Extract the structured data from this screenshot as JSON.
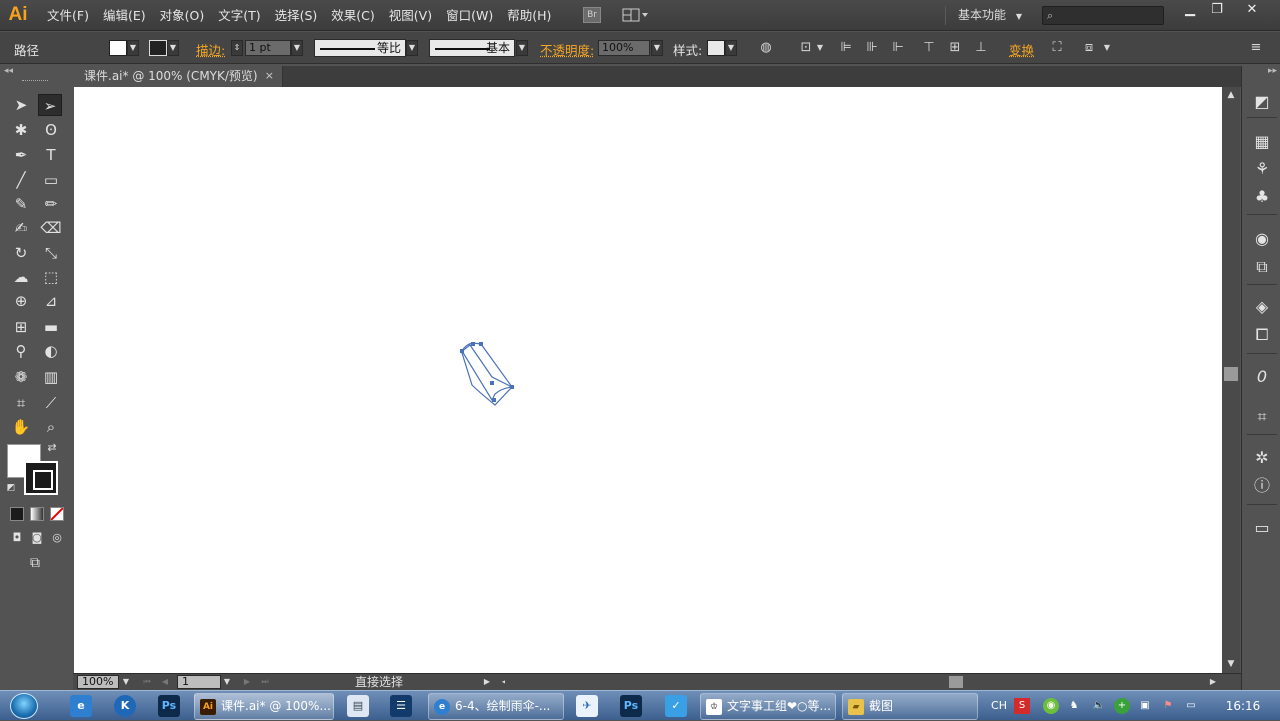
{
  "app": {
    "logo": "Ai",
    "menus": [
      "文件(F)",
      "编辑(E)",
      "对象(O)",
      "文字(T)",
      "选择(S)",
      "效果(C)",
      "视图(V)",
      "窗口(W)",
      "帮助(H)"
    ],
    "bridge_button": "Br",
    "workspace": "基本功能",
    "search_placeholder": "",
    "window_controls": [
      "minimize-icon",
      "restore-icon",
      "close-icon"
    ]
  },
  "control_bar": {
    "selection_type": "路径",
    "stroke_label": "描边:",
    "stroke_weight": "1 pt",
    "profile": "等比",
    "brush": "基本",
    "opacity_label": "不透明度:",
    "opacity_value": "100%",
    "style_label": "样式:",
    "transform_label": "变换"
  },
  "tools": [
    "selection-tool",
    "direct-selection-tool",
    "magic-wand-tool",
    "lasso-tool",
    "pen-tool",
    "type-tool",
    "line-segment-tool",
    "rectangle-tool",
    "paintbrush-tool",
    "pencil-tool",
    "blob-brush-tool",
    "eraser-tool",
    "rotate-tool",
    "scale-tool",
    "warp-tool",
    "free-transform-tool",
    "shape-builder-tool",
    "perspective-grid-tool",
    "mesh-tool",
    "gradient-tool",
    "eyedropper-tool",
    "blend-tool",
    "symbol-sprayer-tool",
    "column-graph-tool",
    "artboard-tool",
    "slice-tool",
    "hand-tool",
    "zoom-tool"
  ],
  "document": {
    "tab_title": "课件.ai* @ 100% (CMYK/预览)",
    "close_glyph": "×"
  },
  "status_bar": {
    "zoom": "100%",
    "artboard": "1",
    "status_text": "直接选择"
  },
  "dock_panels": [
    "color-guide-icon",
    "swatches-icon",
    "brushes-icon",
    "symbols-icon",
    "appearance-icon",
    "graphic-styles-icon",
    "layers-icon",
    "artboards-icon",
    "transparency-icon",
    "transform-icon",
    "navigator-icon",
    "info-icon",
    "gradient-icon"
  ],
  "taskbar": {
    "pinned": [
      "ie-icon",
      "k-icon",
      "photoshop-icon"
    ],
    "tasks": [
      {
        "label": "课件.ai* @ 100%...",
        "icon": "Ai",
        "active": true
      },
      {
        "label": "6-4、绘制雨伞-...",
        "icon": "browser",
        "active": false
      },
      {
        "label": "文字事工组❤○等...",
        "icon": "qq",
        "active": false
      },
      {
        "label": "截图",
        "icon": "folder",
        "active": false
      }
    ],
    "tray_lang": "CH",
    "clock": "16:16"
  },
  "colors": {
    "ai_orange": "#f7a21b",
    "path_blue": "#4a72b8",
    "ui_dark": "#535353"
  }
}
